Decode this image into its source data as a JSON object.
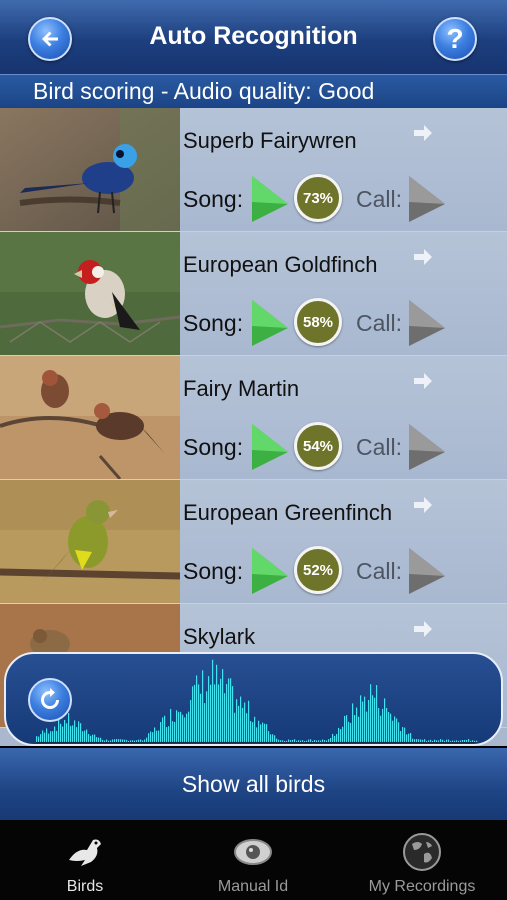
{
  "header": {
    "title": "Auto Recognition",
    "help_label": "?"
  },
  "subheader": {
    "text": "Bird scoring - Audio quality: Good"
  },
  "labels": {
    "song": "Song:",
    "call": "Call:"
  },
  "birds": [
    {
      "name": "Superb Fairywren",
      "score": "73%"
    },
    {
      "name": "European Goldfinch",
      "score": "58%"
    },
    {
      "name": "Fairy Martin",
      "score": "54%"
    },
    {
      "name": "European Greenfinch",
      "score": "52%"
    },
    {
      "name": "Skylark",
      "score": ""
    }
  ],
  "show_all": "Show all birds",
  "tabs": [
    {
      "label": "Birds",
      "icon": "bird-icon",
      "active": true
    },
    {
      "label": "Manual Id",
      "icon": "eye-icon",
      "active": false
    },
    {
      "label": "My Recordings",
      "icon": "globe-icon",
      "active": false
    }
  ],
  "colors": {
    "header": "#1d3f7e",
    "score_badge": "#6f742b",
    "play_song": "#3cb043",
    "play_call": "#6e6e6e",
    "waveform": "#41e3f0"
  }
}
